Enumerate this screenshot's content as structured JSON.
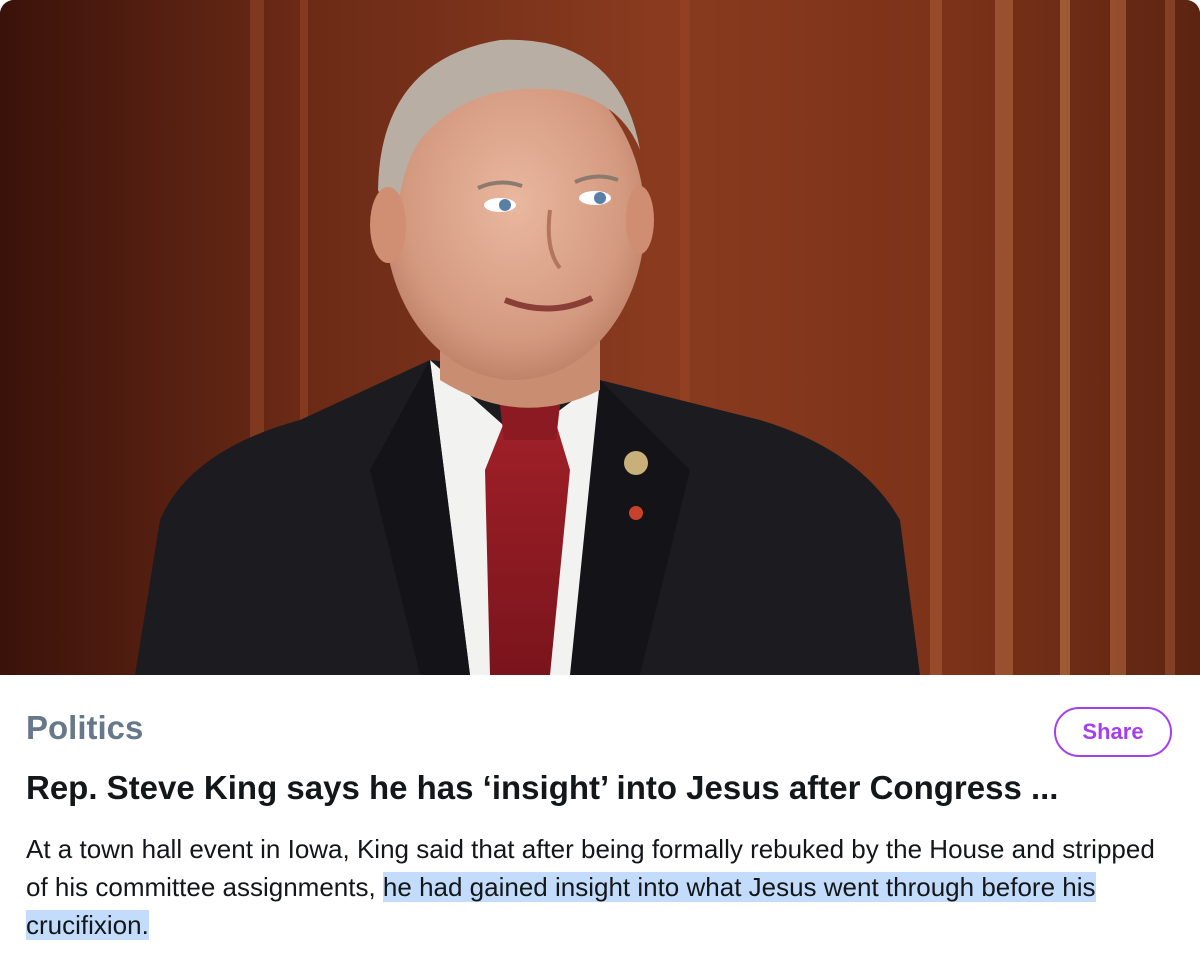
{
  "article": {
    "category": "Politics",
    "share_label": "Share",
    "headline": "Rep. Steve King says he has ‘insight’ into Jesus after Congress ...",
    "summary_plain": "At a town hall event in Iowa, King said that after being formally rebuked by the House and stripped of his committee assignments, ",
    "summary_highlight": "he had gained insight into what Jesus went through before his crucifixion."
  },
  "colors": {
    "category": "#66788a",
    "accent": "#a33ff0",
    "highlight": "#c3dcfb"
  }
}
